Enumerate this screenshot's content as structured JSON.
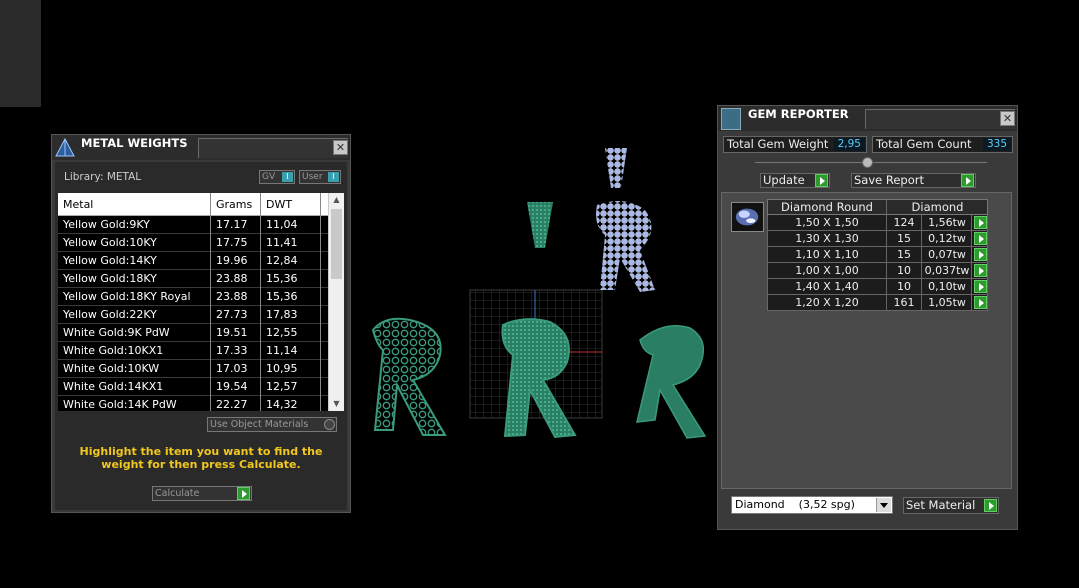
{
  "metal_weights": {
    "title": "METAL WEIGHTS",
    "library_label": "Library: METAL",
    "toggle_gv": "GV",
    "toggle_user": "User",
    "toggle_state": "I",
    "columns": [
      "Metal",
      "Grams",
      "DWT"
    ],
    "rows": [
      {
        "metal": "Yellow Gold:9KY",
        "grams": "17.17",
        "dwt": "11,04"
      },
      {
        "metal": "Yellow Gold:10KY",
        "grams": "17.75",
        "dwt": "11,41"
      },
      {
        "metal": "Yellow Gold:14KY",
        "grams": "19.96",
        "dwt": "12,84"
      },
      {
        "metal": "Yellow Gold:18KY",
        "grams": "23.88",
        "dwt": "15,36"
      },
      {
        "metal": "Yellow Gold:18KY Royal",
        "grams": "23.88",
        "dwt": "15,36"
      },
      {
        "metal": "Yellow Gold:22KY",
        "grams": "27.73",
        "dwt": "17,83"
      },
      {
        "metal": "White Gold:9K PdW",
        "grams": "19.51",
        "dwt": "12,55"
      },
      {
        "metal": "White Gold:10KX1",
        "grams": "17.33",
        "dwt": "11,14"
      },
      {
        "metal": "White Gold:10KW",
        "grams": "17.03",
        "dwt": "10,95"
      },
      {
        "metal": "White Gold:14KX1",
        "grams": "19.54",
        "dwt": "12,57"
      },
      {
        "metal": "White Gold:14K PdW",
        "grams": "22.27",
        "dwt": "14,32"
      }
    ],
    "use_object_materials": "Use Object Materials",
    "hint": "Highlight the item you want to find the weight for then press Calculate.",
    "calculate_label": "Calculate"
  },
  "gem_reporter": {
    "title": "GEM REPORTER",
    "total_weight_label": "Total Gem Weight",
    "total_weight_value": "2,95",
    "total_count_label": "Total Gem Count",
    "total_count_value": "335",
    "update_label": "Update",
    "save_report_label": "Save Report",
    "grid_headers": [
      "Diamond Round",
      "Diamond"
    ],
    "gems": [
      {
        "size": "1,50 X 1,50",
        "count": "124",
        "weight": "1,56tw"
      },
      {
        "size": "1,30 X 1,30",
        "count": "15",
        "weight": "0,12tw"
      },
      {
        "size": "1,10 X 1,10",
        "count": "15",
        "weight": "0,07tw"
      },
      {
        "size": "1,00 X 1,00",
        "count": "10",
        "weight": "0,037tw"
      },
      {
        "size": "1,40 X 1,40",
        "count": "10",
        "weight": "0,10tw"
      },
      {
        "size": "1,20 X 1,20",
        "count": "161",
        "weight": "1,05tw"
      }
    ],
    "material_select": "Diamond    (3,52 spg)",
    "set_material_label": "Set Material"
  },
  "colors": {
    "highlight_text": "#f2c81e",
    "value_text": "#5ad0ff",
    "model_teal": "#2e8a6e",
    "stone_blue": "#a8b8e8"
  }
}
